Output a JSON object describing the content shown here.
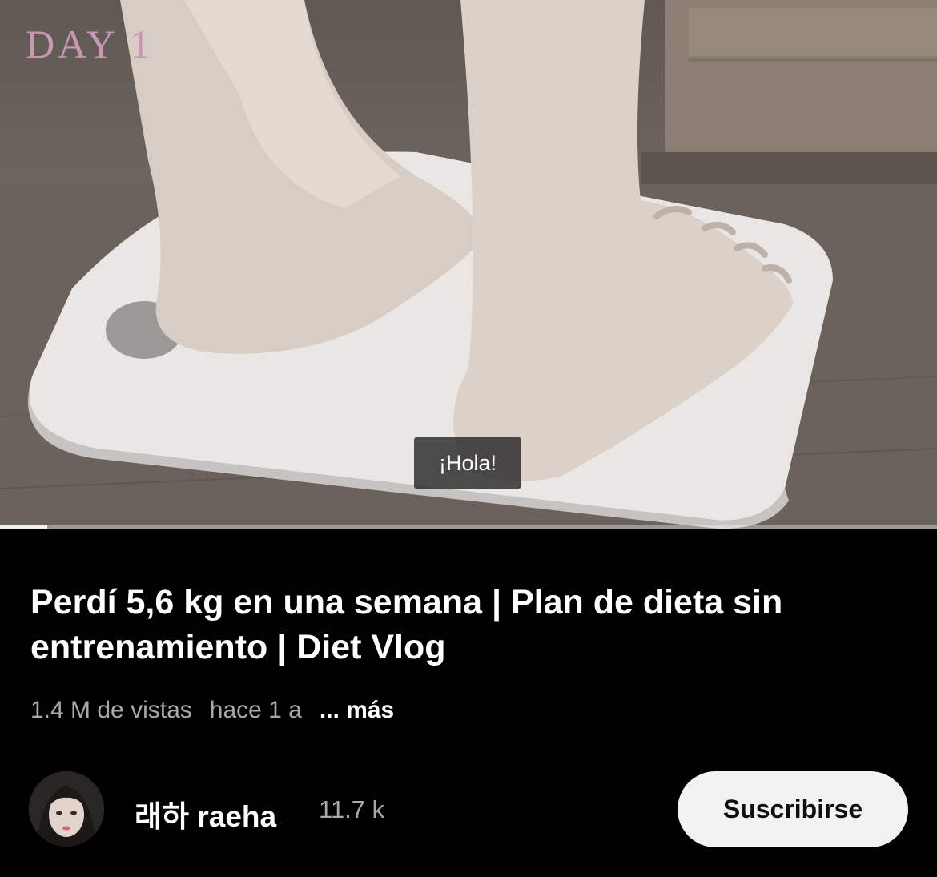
{
  "video": {
    "overlay_text": "DAY 1",
    "caption": "¡Hola!",
    "progress_fraction": 0.05
  },
  "title": "Perdí 5,6 kg en una semana | Plan de dieta sin entrenamiento | Diet Vlog",
  "meta": {
    "views": "1.4 M de vistas",
    "age": "hace 1 a",
    "more_label": "... más"
  },
  "channel": {
    "name": "래하 raeha",
    "subscribers": "11.7 k",
    "subscribe_label": "Suscribirse"
  },
  "colors": {
    "background": "#000000",
    "overlay_text": "#c996b3",
    "subscribe_button": "#f2f2f2",
    "secondary_text": "#a9a9a9"
  }
}
